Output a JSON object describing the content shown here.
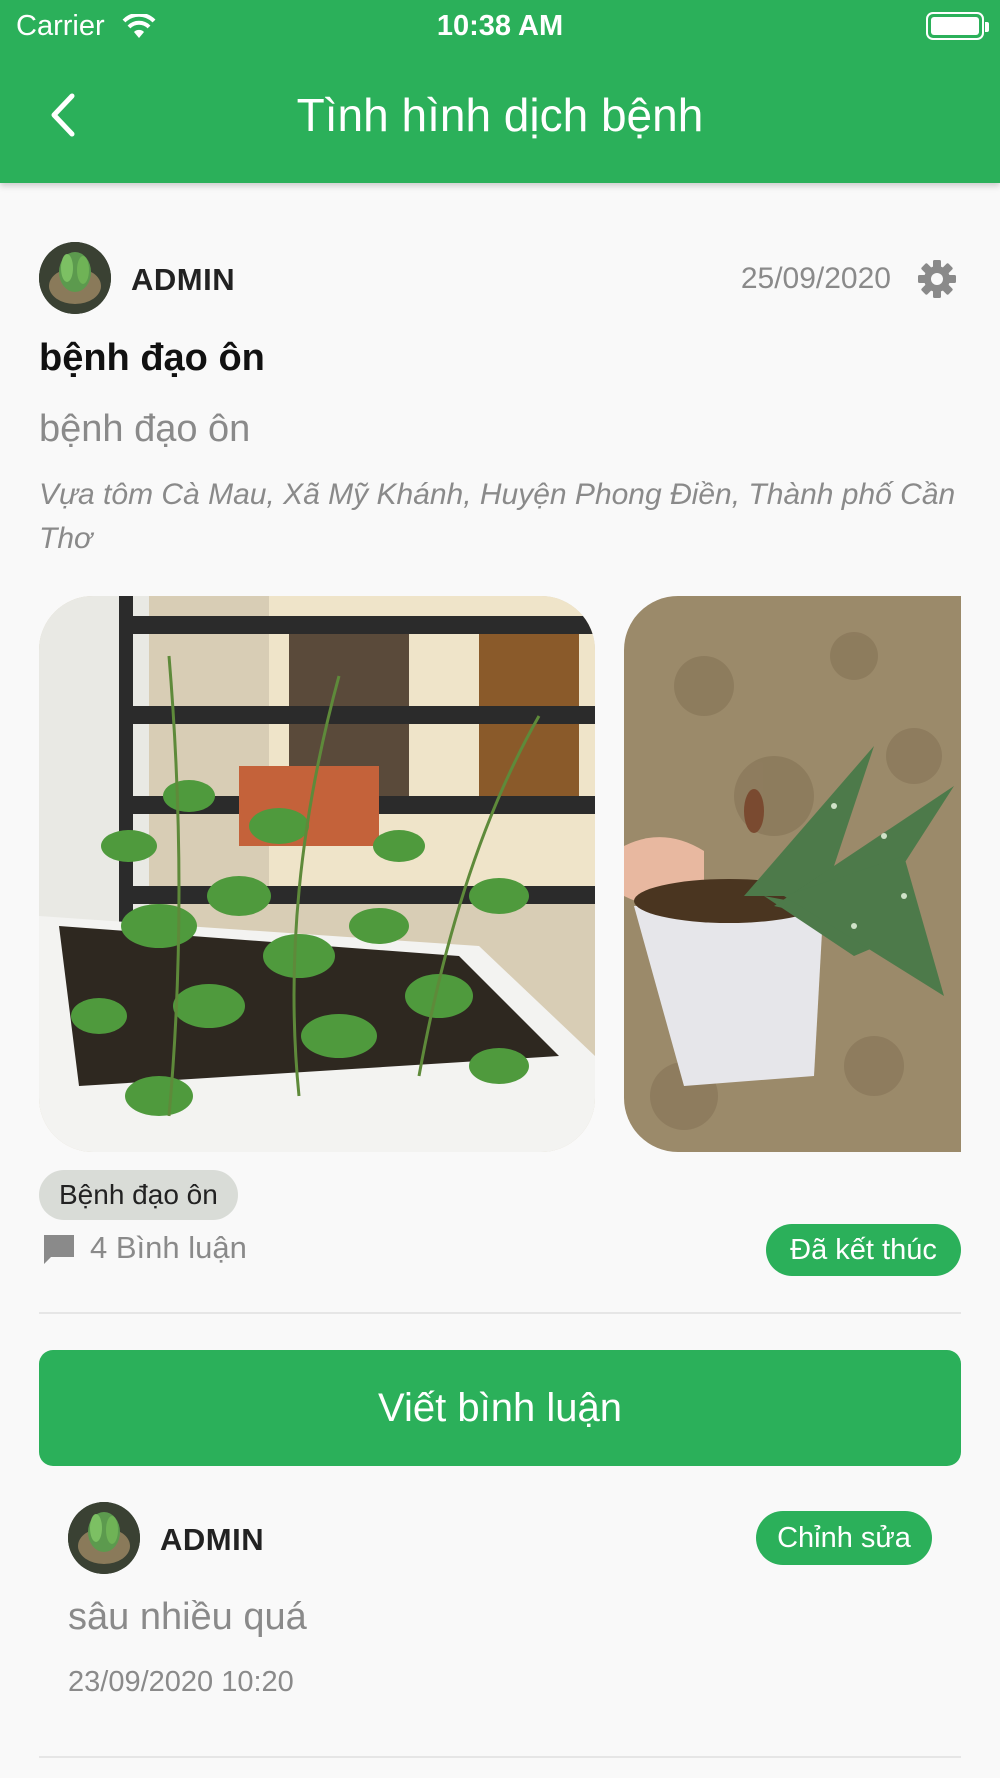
{
  "status_bar": {
    "carrier": "Carrier",
    "time": "10:38 AM",
    "battery_level": 1.0
  },
  "header": {
    "title": "Tình hình dịch bệnh",
    "back_icon": "chevron-left-icon"
  },
  "post": {
    "author": "ADMIN",
    "date": "25/09/2020",
    "settings_icon": "gear-icon",
    "title": "bệnh đạo ôn",
    "description": "bệnh đạo ôn",
    "location": "Vựa tôm Cà Mau, Xã Mỹ Khánh, Huyện Phong Điền, Thành phố Cần Thơ",
    "tag": "Bệnh đạo ôn",
    "comment_count_label": "4 Bình luận",
    "status": "Đã kết thúc"
  },
  "actions": {
    "write_comment": "Viết bình luận"
  },
  "comments": [
    {
      "author": "ADMIN",
      "edit_label": "Chỉnh sửa",
      "text": "sâu nhiều quá",
      "timestamp": "23/09/2020 10:20"
    }
  ],
  "colors": {
    "primary": "#2bb05a",
    "background": "#f9f9f9",
    "muted_text": "#8a8a8a",
    "tag_bg": "#d9dcd7"
  }
}
